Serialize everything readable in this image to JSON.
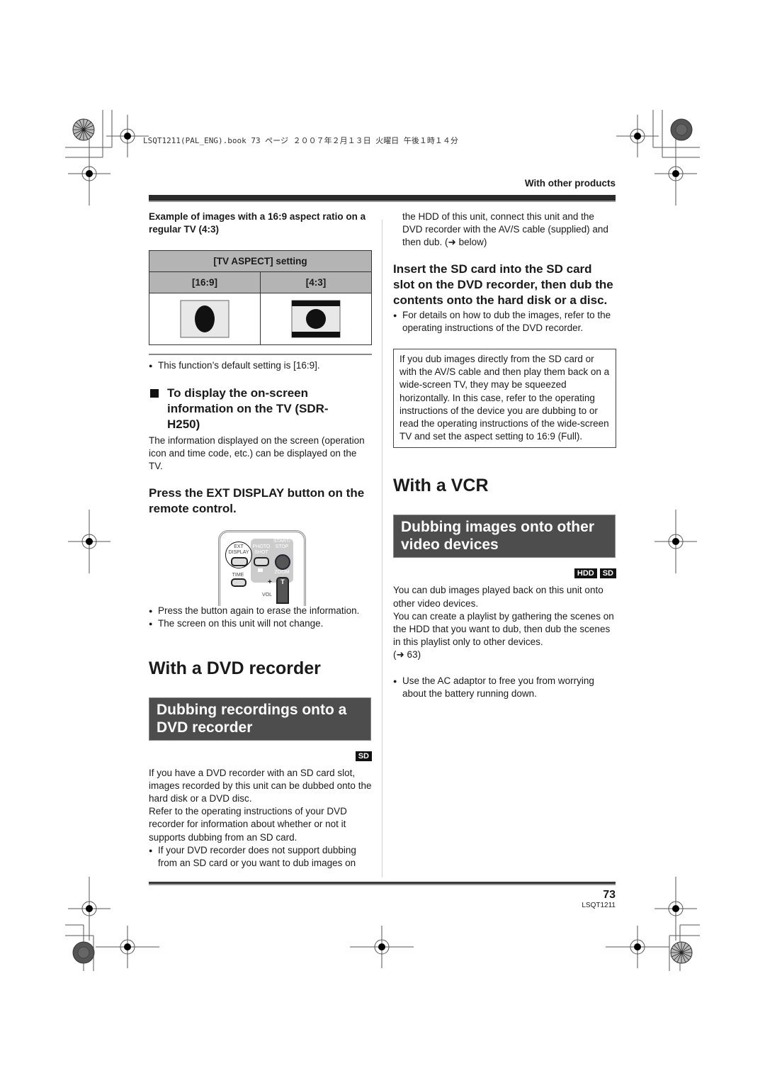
{
  "print_header": "LSQT1211(PAL_ENG).book  73 ページ  ２００７年２月１３日  火曜日  午後１時１４分",
  "section_label": "With other products",
  "left": {
    "example_caption": "Example of images with a 16:9 aspect ratio on a regular TV (4:3)",
    "table": {
      "header": "[TV ASPECT] setting",
      "columns": [
        "[16:9]",
        "[4:3]"
      ],
      "images": [
        "squeezed-circle-image",
        "letterbox-circle-image"
      ]
    },
    "default_note": "This function’s default setting is [16:9].",
    "onscreen_heading": "To display the on-screen information on the TV (SDR-H250)",
    "onscreen_body": "The information displayed on the screen (operation icon and time code, etc.) can be displayed on the TV.",
    "step_ext_display": "Press the EXT DISPLAY button on the remote control.",
    "remote": {
      "ext_display": "EXT DISPLAY",
      "photo_shot": "PHOTO SHOT",
      "start_stop": "START/ STOP",
      "time": "TIME",
      "zoom": "ZOOM",
      "vol": "VOL",
      "t": "T",
      "plus": "+"
    },
    "bullets_after_remote": [
      "Press the button again to erase the information.",
      "The screen on this unit will not change."
    ],
    "dvd_heading": "With a DVD recorder",
    "dvd_banner": "Dubbing recordings onto a DVD recorder",
    "dvd_badges": [
      "SD"
    ],
    "dvd_body_1": "If you have a DVD recorder with an SD card slot, images recorded by this unit can be dubbed onto the hard disk or a DVD disc.",
    "dvd_body_2": "Refer to the operating instructions of your DVD recorder for information about whether or not it supports dubbing from an SD card.",
    "dvd_bullet": "If your DVD recorder does not support dubbing from an SD card or you want to dub images on"
  },
  "right": {
    "continued_text": "the HDD of this unit, connect this unit and the DVD recorder with the AV/S cable (supplied) and then dub. (➜ below)",
    "step_insert": "Insert the SD card into the SD card slot on the DVD recorder, then dub the contents onto the hard disk or a disc.",
    "insert_bullet": "For details on how to dub the images, refer to the operating instructions of the DVD recorder.",
    "note_box": "If you dub images directly from the SD card or with the AV/S cable and then play them back on a wide-screen TV, they may be squeezed horizontally. In this case, refer to the operating instructions of the device you are dubbing to or read the operating instructions of the wide-screen TV and set the aspect setting to 16:9 (Full).",
    "vcr_heading": "With a VCR",
    "vcr_banner": "Dubbing images onto other video devices",
    "vcr_badges": [
      "HDD",
      "SD"
    ],
    "vcr_body_1": "You can dub images played back on this unit onto other video devices.",
    "vcr_body_2": "You can create a playlist by gathering the scenes on the HDD that you want to dub, then dub the scenes in this playlist only to other devices.",
    "vcr_ref": "(➜ 63)",
    "vcr_bullet": "Use the AC adaptor to free you from worrying about the battery running down."
  },
  "footer": {
    "page_number": "73",
    "doc_code": "LSQT1211"
  }
}
